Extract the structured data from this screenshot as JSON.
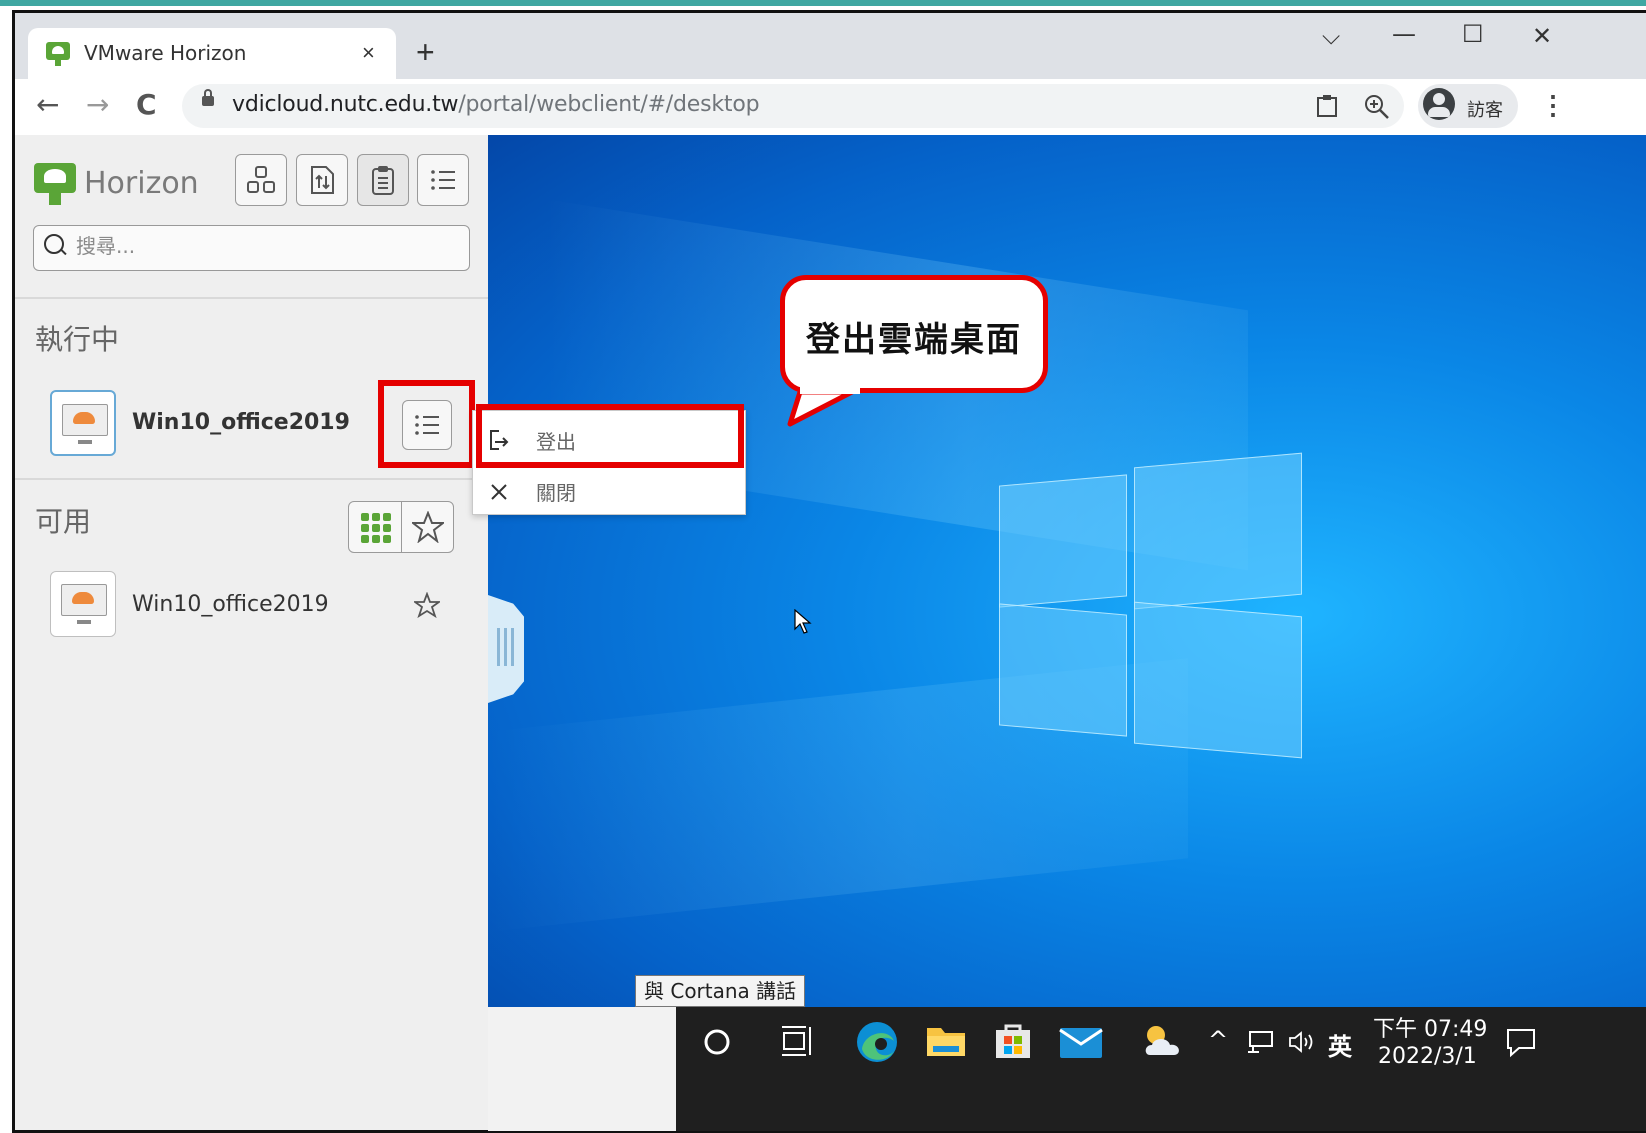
{
  "browser": {
    "tab_title": "VMware Horizon",
    "tab_close": "×",
    "new_tab": "+",
    "window_controls": {
      "dropdown": "⌵",
      "minimize": "—",
      "maximize": "☐",
      "close": "✕"
    },
    "nav": {
      "back": "←",
      "forward": "→",
      "reload": "C"
    },
    "url_domain": "vdicloud.nutc.edu.tw",
    "url_path": "/portal/webclient/#/desktop",
    "profile_label": "訪客",
    "menu": "⋮"
  },
  "sidebar": {
    "logo_text": "Horizon",
    "search_placeholder": "搜尋...",
    "running_title": "執行中",
    "running_items": [
      {
        "name": "Win10_office2019"
      }
    ],
    "available_title": "可用",
    "available_items": [
      {
        "name": "Win10_office2019"
      }
    ]
  },
  "context_menu": {
    "items": [
      {
        "label": "登出",
        "icon": "logout-icon"
      },
      {
        "label": "關閉",
        "icon": "close-icon"
      }
    ]
  },
  "callout": {
    "text": "登出雲端桌面"
  },
  "desktop": {
    "cortana_tooltip": "與 Cortana 講話"
  },
  "taskbar": {
    "tray_chevron": "^",
    "language": "英",
    "time": "下午 07:49",
    "date": "2022/3/1"
  },
  "colors": {
    "highlight_red": "#e50000",
    "horizon_green": "#5aa537",
    "desktop_blue": "#0a86e6"
  }
}
